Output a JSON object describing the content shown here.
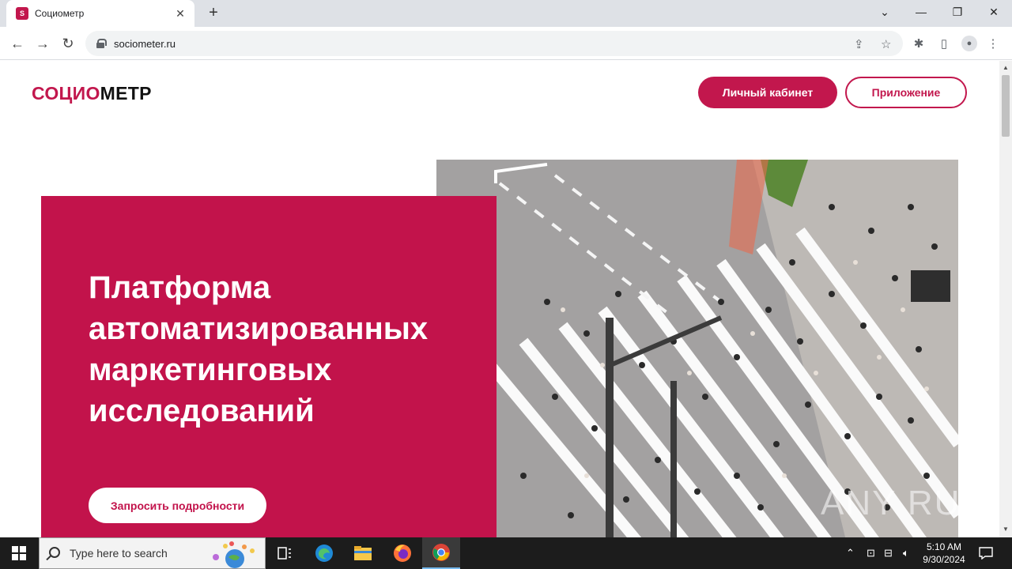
{
  "browser": {
    "tab_title": "Социометр",
    "favicon_letter": "S",
    "url": "sociometer.ru",
    "new_tab": "+",
    "close_tab": "✕"
  },
  "site": {
    "logo_part1": "СОЦИО",
    "logo_part2": "МЕТР",
    "cabinet_button": "Личный кабинет",
    "app_button": "Приложение",
    "hero_title": "Платформа автоматизированных маркетинговых исследований",
    "request_button": "Запросить подробности",
    "accent_color": "#c2134b"
  },
  "watermark": "ANY RUN",
  "taskbar": {
    "search_placeholder": "Type here to search",
    "time": "5:10 AM",
    "date": "9/30/2024"
  }
}
